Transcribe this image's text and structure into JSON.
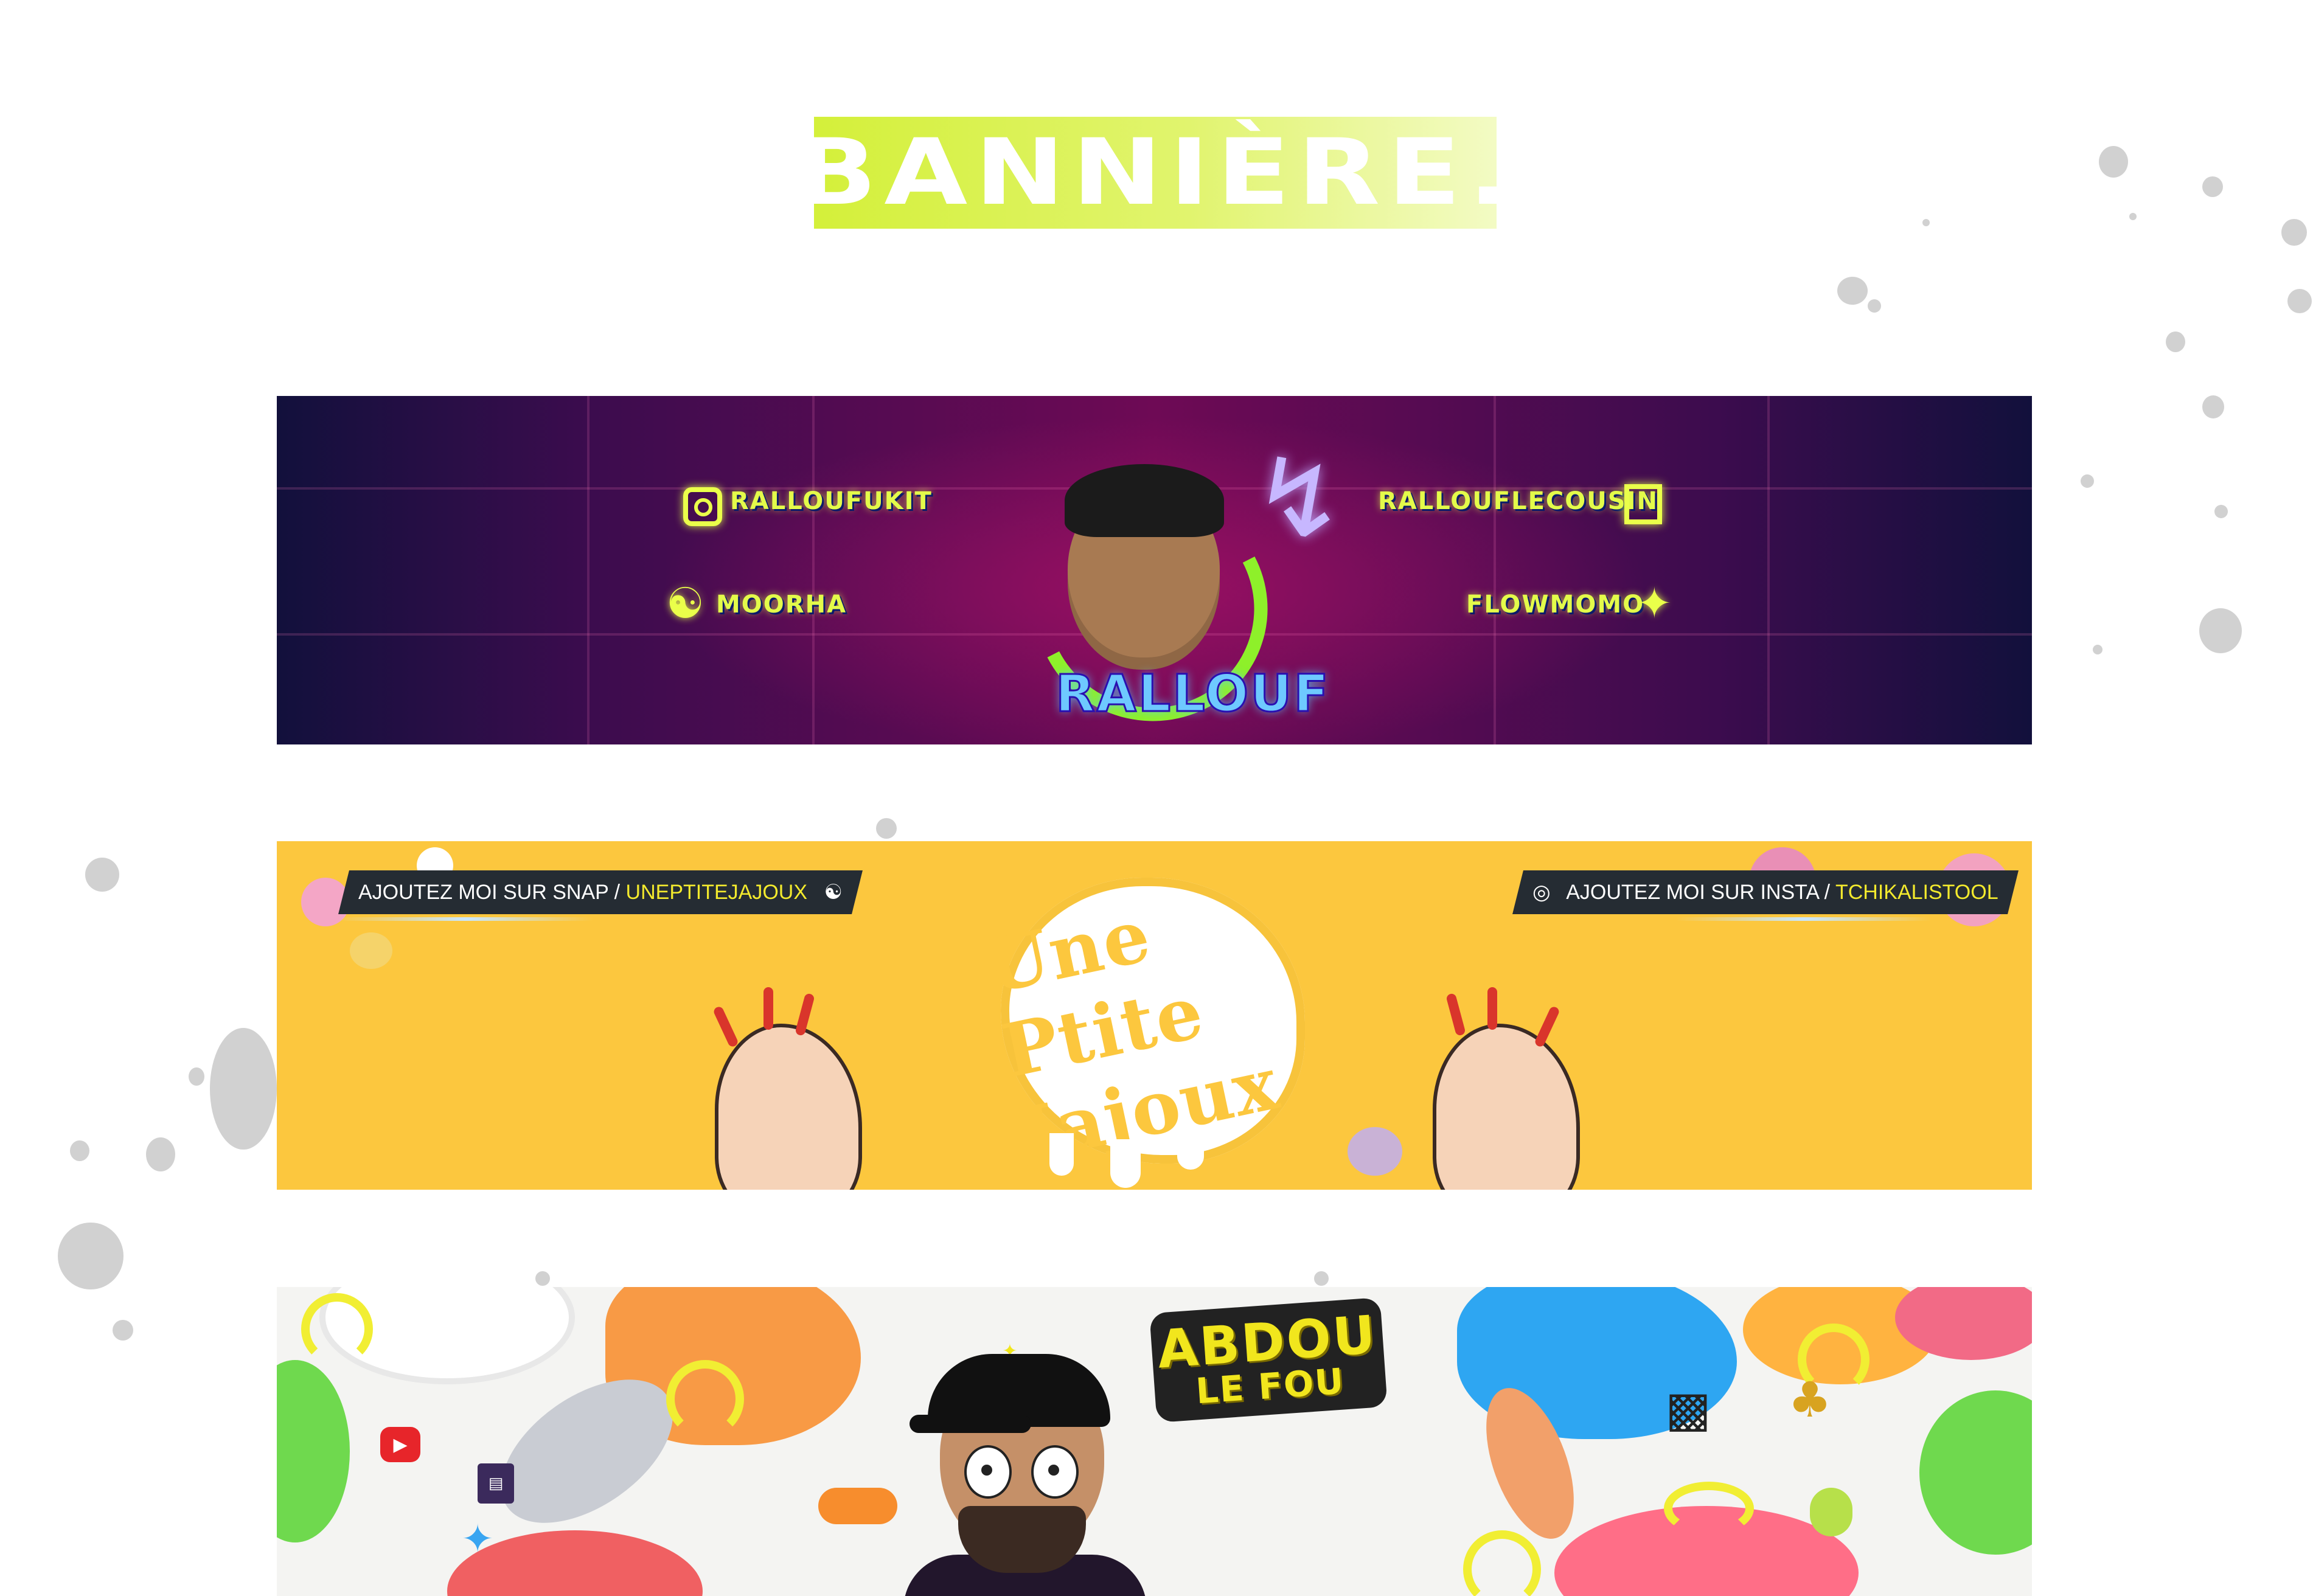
{
  "header": {
    "title": "BANNIÈRE."
  },
  "banners": [
    {
      "name": "rallouf",
      "socials": {
        "instagram": "RALLOUFUKIT",
        "snapchat": "MOORHA",
        "twitch": "RALLOUFLECOUSIN",
        "twitter": "FLOWMOMO"
      },
      "wordmark": "RALLOUF"
    },
    {
      "name": "uneptitejajoux",
      "snap_tag": {
        "prefix": "AJOUTEZ MOI SUR SNAP / ",
        "handle": "UNEPTITEJAJOUX"
      },
      "insta_tag": {
        "prefix": "AJOUTEZ MOI SUR INSTA / ",
        "handle": "TCHIKALISTOOL"
      },
      "logo_text": "Une Ptite Jajoux"
    },
    {
      "name": "abdou-le-fou",
      "logo_line1": "ABDOU",
      "logo_line2": "LE FOU"
    }
  ],
  "colors": {
    "accent_lime": "#d4f03a",
    "neon_yellow": "#eaff4a",
    "banner2_yellow": "#fcc73e",
    "abdou_yellow": "#f1e61d"
  },
  "icons": [
    "instagram-icon",
    "snapchat-icon",
    "twitch-icon",
    "twitter-icon",
    "youtube-icon",
    "gamepad-icon",
    "trophy-icon",
    "mouse-icon"
  ]
}
